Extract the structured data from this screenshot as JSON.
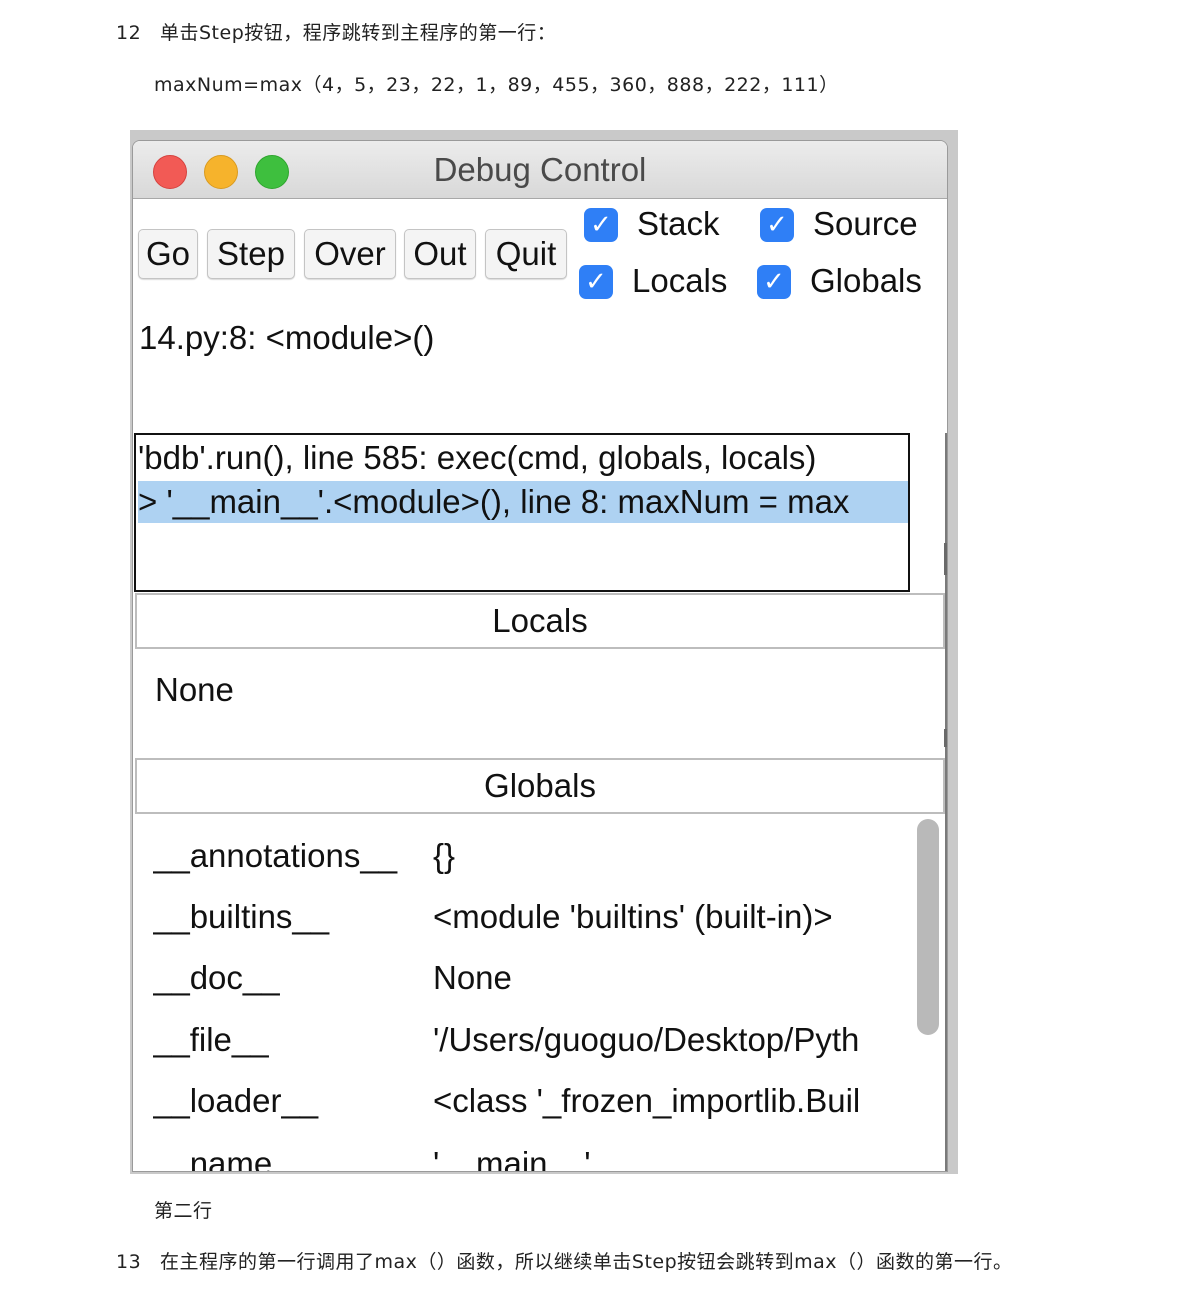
{
  "document": {
    "step12": {
      "number": "12",
      "text": "单击Step按钮，程序跳转到主程序的第一行："
    },
    "code_line": "maxNum=max（4，5，23，22，1，89，455，360，888，222，111）",
    "caption": "第二行",
    "step13": {
      "number": "13",
      "text": "在主程序的第一行调用了max（）函数，所以继续单击Step按钮会跳转到max（）函数的第一行。"
    }
  },
  "window": {
    "title": "Debug Control",
    "buttons": {
      "go": "Go",
      "step": "Step",
      "over": "Over",
      "out": "Out",
      "quit": "Quit"
    },
    "checkboxes": {
      "stack": {
        "label": "Stack",
        "checked": true
      },
      "source": {
        "label": "Source",
        "checked": true
      },
      "locals": {
        "label": "Locals",
        "checked": true
      },
      "globals": {
        "label": "Globals",
        "checked": true
      }
    },
    "check_glyph": "✓",
    "location": "14.py:8: <module>()",
    "stack": [
      "'bdb'.run(), line 585: exec(cmd, globals, locals)",
      "> '__main__'.<module>(), line 8: maxNum = max"
    ],
    "locals": {
      "title": "Locals",
      "value": "None"
    },
    "globals": {
      "title": "Globals",
      "rows": [
        {
          "name": "__annotations__",
          "value": "{}"
        },
        {
          "name": "__builtins__",
          "value": "<module 'builtins' (built-in)>"
        },
        {
          "name": "__doc__",
          "value": "None"
        },
        {
          "name": "__file__",
          "value": "'/Users/guoguo/Desktop/Pyth"
        },
        {
          "name": "__loader__",
          "value": "<class '_frozen_importlib.Buil"
        },
        {
          "name": "__name__",
          "value": "'__main__'"
        }
      ]
    }
  }
}
